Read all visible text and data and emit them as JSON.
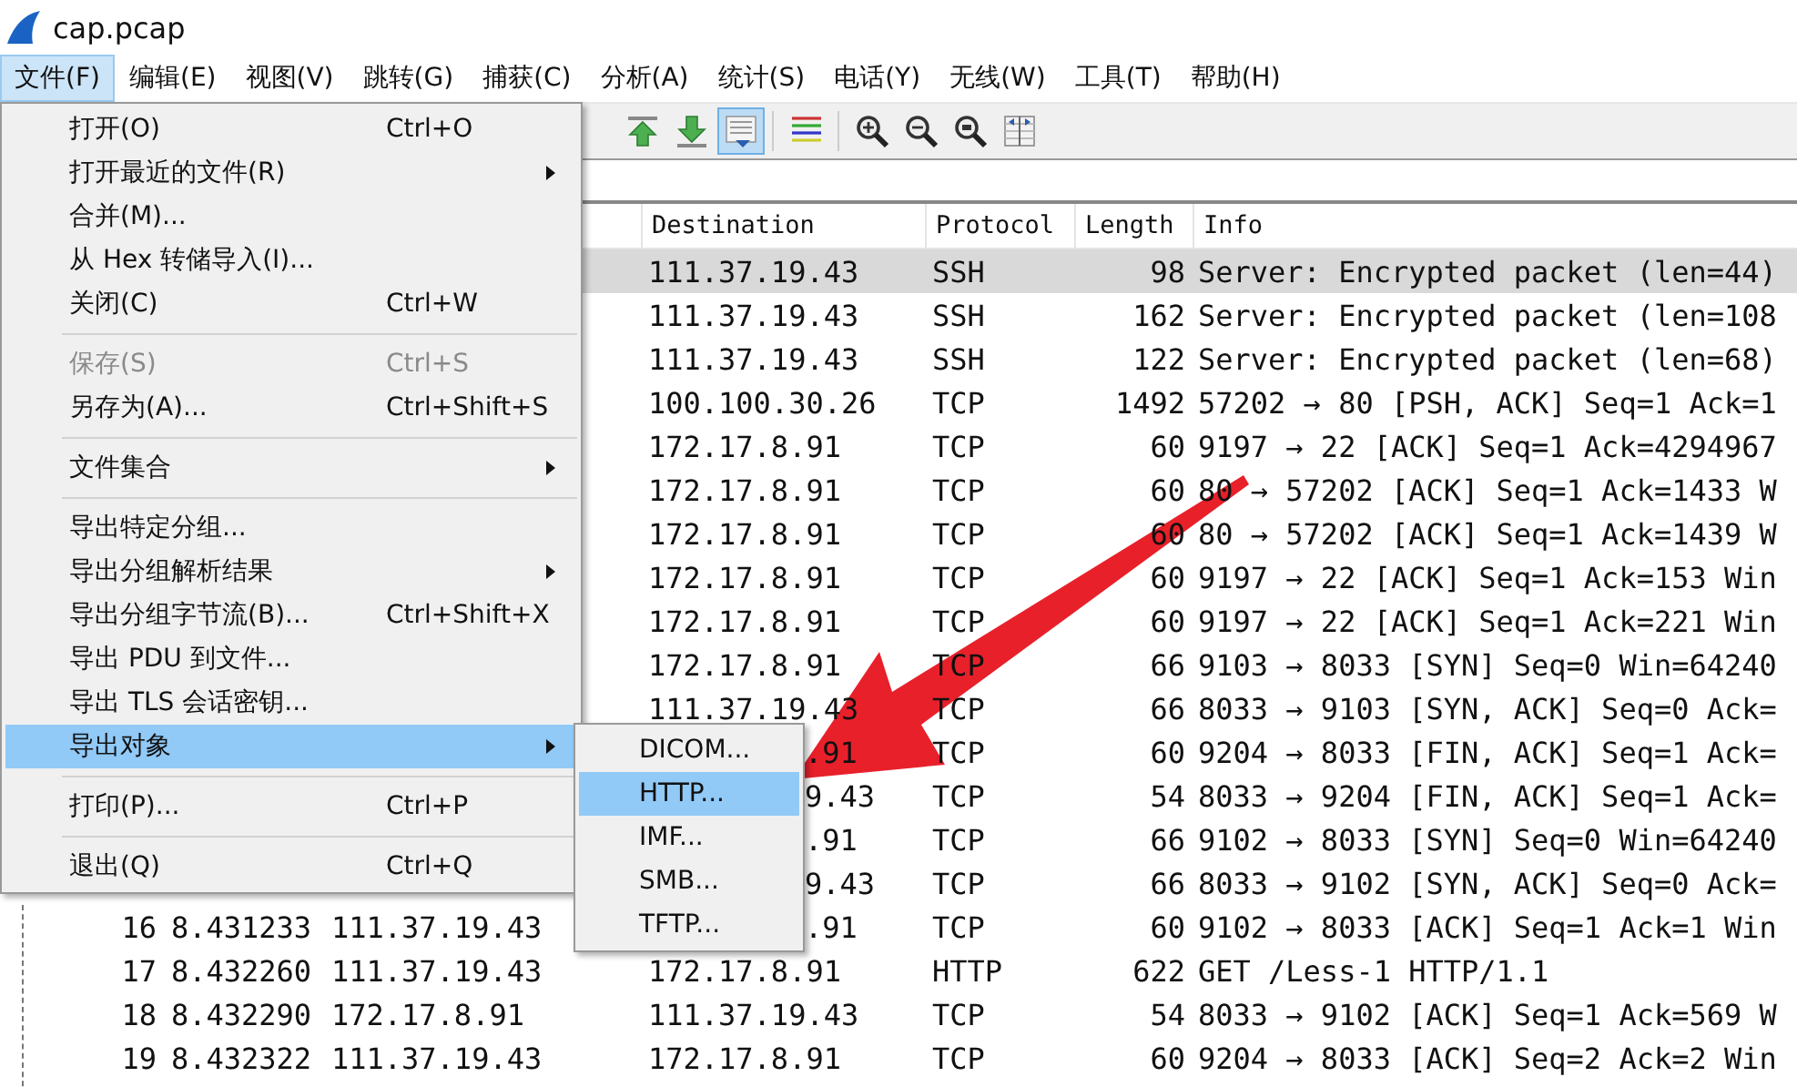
{
  "window": {
    "title": "cap.pcap"
  },
  "menubar": [
    {
      "label": "文件(F)",
      "selected": true
    },
    {
      "label": "编辑(E)",
      "selected": false
    },
    {
      "label": "视图(V)",
      "selected": false
    },
    {
      "label": "跳转(G)",
      "selected": false
    },
    {
      "label": "捕获(C)",
      "selected": false
    },
    {
      "label": "分析(A)",
      "selected": false
    },
    {
      "label": "统计(S)",
      "selected": false
    },
    {
      "label": "电话(Y)",
      "selected": false
    },
    {
      "label": "无线(W)",
      "selected": false
    },
    {
      "label": "工具(T)",
      "selected": false
    },
    {
      "label": "帮助(H)",
      "selected": false
    }
  ],
  "toolbar": [
    {
      "kind": "first",
      "selected": false
    },
    {
      "kind": "last",
      "selected": false
    },
    {
      "kind": "autoscroll",
      "selected": true
    },
    {
      "kind": "separator"
    },
    {
      "kind": "colorize",
      "selected": false
    },
    {
      "kind": "separator"
    },
    {
      "kind": "zoom-in",
      "selected": false
    },
    {
      "kind": "zoom-out",
      "selected": false
    },
    {
      "kind": "zoom-reset",
      "selected": false
    },
    {
      "kind": "resize-columns",
      "selected": false
    }
  ],
  "table": {
    "columns": [
      "Destination",
      "Protocol",
      "Length",
      "Info"
    ],
    "rows": [
      {
        "destination": "111.37.19.43",
        "protocol": "SSH",
        "length": "98",
        "info": "Server: Encrypted packet (len=44)",
        "selected": true
      },
      {
        "destination": "111.37.19.43",
        "protocol": "SSH",
        "length": "162",
        "info": "Server: Encrypted packet (len=108",
        "selected": false
      },
      {
        "destination": "111.37.19.43",
        "protocol": "SSH",
        "length": "122",
        "info": "Server: Encrypted packet (len=68)",
        "selected": false
      },
      {
        "destination": "100.100.30.26",
        "protocol": "TCP",
        "length": "1492",
        "info": "57202 → 80 [PSH, ACK] Seq=1 Ack=1",
        "selected": false
      },
      {
        "destination": "172.17.8.91",
        "protocol": "TCP",
        "length": "60",
        "info": "9197 → 22 [ACK] Seq=1 Ack=4294967",
        "selected": false
      },
      {
        "destination": "172.17.8.91",
        "protocol": "TCP",
        "length": "60",
        "info": "80 → 57202 [ACK] Seq=1 Ack=1433 W",
        "selected": false
      },
      {
        "destination": "172.17.8.91",
        "protocol": "TCP",
        "length": "60",
        "info": "80 → 57202 [ACK] Seq=1 Ack=1439 W",
        "selected": false
      },
      {
        "destination": "172.17.8.91",
        "protocol": "TCP",
        "length": "60",
        "info": "9197 → 22 [ACK] Seq=1 Ack=153 Win",
        "selected": false
      },
      {
        "destination": "172.17.8.91",
        "protocol": "TCP",
        "length": "60",
        "info": "9197 → 22 [ACK] Seq=1 Ack=221 Win",
        "selected": false
      },
      {
        "destination": "172.17.8.91",
        "protocol": "TCP",
        "length": "66",
        "info": "9103 → 8033 [SYN] Seq=0 Win=64240",
        "selected": false
      },
      {
        "destination": "111.37.19.43",
        "protocol": "TCP",
        "length": "66",
        "info": "8033 → 9103 [SYN, ACK] Seq=0 Ack=",
        "selected": false
      },
      {
        "destination": ".91",
        "cut": true,
        "protocol": "TCP",
        "length": "60",
        "info": "9204 → 8033 [FIN, ACK] Seq=1 Ack=",
        "selected": false
      },
      {
        "destination": "9.43",
        "cut": true,
        "protocol": "TCP",
        "length": "54",
        "info": "8033 → 9204 [FIN, ACK] Seq=1 Ack=",
        "selected": false
      },
      {
        "destination": ".91",
        "cut": true,
        "protocol": "TCP",
        "length": "66",
        "info": "9102 → 8033 [SYN] Seq=0 Win=64240",
        "selected": false
      },
      {
        "destination": "9.43",
        "cut": true,
        "protocol": "TCP",
        "length": "66",
        "info": "8033 → 9102 [SYN, ACK] Seq=0 Ack=",
        "selected": false
      },
      {
        "no": "16",
        "time": "8.431233",
        "source": "111.37.19.43",
        "destination": ".91",
        "cut": true,
        "protocol": "TCP",
        "length": "60",
        "info": "9102 → 8033 [ACK] Seq=1 Ack=1 Win",
        "selected": false
      },
      {
        "no": "17",
        "time": "8.432260",
        "source": "111.37.19.43",
        "destination": "172.17.8.91",
        "protocol": "HTTP",
        "length": "622",
        "info": "GET /Less-1 HTTP/1.1",
        "selected": false
      },
      {
        "no": "18",
        "time": "8.432290",
        "source": "172.17.8.91",
        "destination": "111.37.19.43",
        "protocol": "TCP",
        "length": "54",
        "info": "8033 → 9102 [ACK] Seq=1 Ack=569 W",
        "selected": false
      },
      {
        "no": "19",
        "time": "8.432322",
        "source": "111.37.19.43",
        "destination": "172.17.8.91",
        "protocol": "TCP",
        "length": "60",
        "info": "9204 → 8033 [ACK] Seq=2 Ack=2 Win",
        "selected": false
      }
    ]
  },
  "file_menu": [
    {
      "kind": "item",
      "label": "打开(O)",
      "shortcut": "Ctrl+O",
      "submenu": false,
      "disabled": false,
      "selected": false
    },
    {
      "kind": "item",
      "label": "打开最近的文件(R)",
      "submenu": true,
      "disabled": false,
      "selected": false
    },
    {
      "kind": "item",
      "label": "合并(M)...",
      "submenu": false,
      "disabled": false,
      "selected": false
    },
    {
      "kind": "item",
      "label": "从 Hex 转储导入(I)...",
      "submenu": false,
      "disabled": false,
      "selected": false
    },
    {
      "kind": "item",
      "label": "关闭(C)",
      "shortcut": "Ctrl+W",
      "submenu": false,
      "disabled": false,
      "selected": false
    },
    {
      "kind": "separator"
    },
    {
      "kind": "item",
      "label": "保存(S)",
      "shortcut": "Ctrl+S",
      "submenu": false,
      "disabled": true,
      "selected": false
    },
    {
      "kind": "item",
      "label": "另存为(A)...",
      "shortcut": "Ctrl+Shift+S",
      "submenu": false,
      "disabled": false,
      "selected": false
    },
    {
      "kind": "separator"
    },
    {
      "kind": "item",
      "label": "文件集合",
      "submenu": true,
      "disabled": false,
      "selected": false
    },
    {
      "kind": "separator"
    },
    {
      "kind": "item",
      "label": "导出特定分组...",
      "submenu": false,
      "disabled": false,
      "selected": false
    },
    {
      "kind": "item",
      "label": "导出分组解析结果",
      "submenu": true,
      "disabled": false,
      "selected": false
    },
    {
      "kind": "item",
      "label": "导出分组字节流(B)...",
      "shortcut": "Ctrl+Shift+X",
      "submenu": false,
      "disabled": false,
      "selected": false
    },
    {
      "kind": "item",
      "label": "导出 PDU 到文件...",
      "submenu": false,
      "disabled": false,
      "selected": false
    },
    {
      "kind": "item",
      "label": "导出 TLS 会话密钥...",
      "submenu": false,
      "disabled": false,
      "selected": false
    },
    {
      "kind": "item",
      "label": "导出对象",
      "submenu": true,
      "disabled": false,
      "selected": true
    },
    {
      "kind": "separator"
    },
    {
      "kind": "item",
      "label": "打印(P)...",
      "shortcut": "Ctrl+P",
      "submenu": false,
      "disabled": false,
      "selected": false
    },
    {
      "kind": "separator"
    },
    {
      "kind": "item",
      "label": "退出(Q)",
      "shortcut": "Ctrl+Q",
      "submenu": false,
      "disabled": false,
      "selected": false
    }
  ],
  "export_objects_menu": [
    {
      "label": "DICOM...",
      "selected": false
    },
    {
      "label": "HTTP...",
      "selected": true
    },
    {
      "label": "IMF...",
      "selected": false
    },
    {
      "label": "SMB...",
      "selected": false
    },
    {
      "label": "TFTP...",
      "selected": false
    }
  ]
}
